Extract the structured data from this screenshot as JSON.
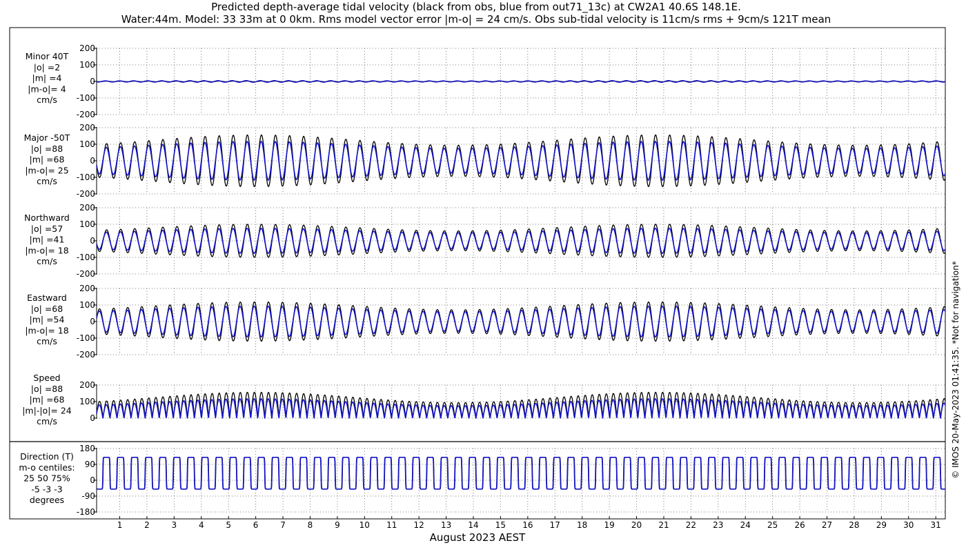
{
  "figure": {
    "title_line1": "Predicted depth-average tidal velocity (black from obs, blue from out71_13c) at CW2A1 40.6S 148.1E.",
    "title_line2": "Water:44m. Model: 33 33m at 0 0km. Rms model vector error |m-o| = 24 cm/s. Obs sub-tidal velocity is 11cm/s rms + 9cm/s 121T mean",
    "xlabel": "August 2023 AEST",
    "credit": "© IMOS 20-May-2023 01:41:35.  *Not for navigation*",
    "colors": {
      "obs": "#000000",
      "model": "#1414c8",
      "grid": "#555555",
      "axes": "#000000"
    }
  },
  "chart_data": {
    "type": "line",
    "x_unit": "day of August 2023 (AEST)",
    "xlim": [
      0.15,
      31.35
    ],
    "x_ticks": [
      1,
      2,
      3,
      4,
      5,
      6,
      7,
      8,
      9,
      10,
      11,
      12,
      13,
      14,
      15,
      16,
      17,
      18,
      19,
      20,
      21,
      22,
      23,
      24,
      25,
      26,
      27,
      28,
      29,
      30,
      31
    ],
    "x_tick_labels": [
      "1",
      "2",
      "3",
      "4",
      "5",
      "6",
      "7",
      "8",
      "9",
      "10",
      "11",
      "12",
      "13",
      "14",
      "15",
      "16",
      "17",
      "18",
      "19",
      "20",
      "21",
      "22",
      "23",
      "24",
      "25",
      "26",
      "27",
      "28",
      "29",
      "30",
      "31"
    ],
    "grid": true,
    "panels": [
      {
        "label_lines": [
          "Minor 40T",
          "|o| =2",
          "|m| =4",
          "|m-o|= 4",
          "cm/s"
        ],
        "ylim": [
          -200,
          200
        ],
        "y_ticks": [
          -200,
          -100,
          0,
          100,
          200
        ],
        "y_tick_labels": [
          "-200",
          "-100",
          "0",
          "100",
          "200"
        ],
        "kind": "harmonic",
        "series": [
          {
            "amplitude": 2,
            "spring_neap": 0.2,
            "phase_deg": 0
          },
          {
            "amplitude": 4,
            "spring_neap": 0.2,
            "phase_deg": 30
          }
        ]
      },
      {
        "label_lines": [
          "Major -50T",
          "|o| =88",
          "|m| =68",
          "|m-o|= 25",
          "cm/s"
        ],
        "ylim": [
          -200,
          200
        ],
        "y_ticks": [
          -200,
          -100,
          0,
          100,
          200
        ],
        "y_tick_labels": [
          "-200",
          "-100",
          "0",
          "100",
          "200"
        ],
        "kind": "harmonic",
        "series": [
          {
            "amplitude": 125,
            "spring_neap": 0.25,
            "phase_deg": 0
          },
          {
            "amplitude": 96,
            "spring_neap": 0.22,
            "phase_deg": 6
          }
        ]
      },
      {
        "label_lines": [
          "Northward",
          "|o| =57",
          "|m| =41",
          "|m-o|= 18",
          "cm/s"
        ],
        "ylim": [
          -200,
          200
        ],
        "y_ticks": [
          -200,
          -100,
          0,
          100,
          200
        ],
        "y_tick_labels": [
          "-200",
          "-100",
          "0",
          "100",
          "200"
        ],
        "kind": "harmonic",
        "series": [
          {
            "amplitude": 80,
            "spring_neap": 0.25,
            "phase_deg": 0
          },
          {
            "amplitude": 62,
            "spring_neap": 0.22,
            "phase_deg": 6
          }
        ]
      },
      {
        "label_lines": [
          "Eastward",
          "|o| =68",
          "|m| =54",
          "|m-o|= 18",
          "cm/s"
        ],
        "ylim": [
          -200,
          200
        ],
        "y_ticks": [
          -200,
          -100,
          0,
          100,
          200
        ],
        "y_tick_labels": [
          "-200",
          "-100",
          "0",
          "100",
          "200"
        ],
        "kind": "harmonic",
        "series": [
          {
            "amplitude": 95,
            "spring_neap": 0.25,
            "phase_deg": 180
          },
          {
            "amplitude": 76,
            "spring_neap": 0.22,
            "phase_deg": 186
          }
        ]
      },
      {
        "label_lines": [
          "Speed",
          "|o| =88",
          "|m| =68",
          "|m|-|o|= 24",
          "cm/s"
        ],
        "ylim": [
          0,
          200
        ],
        "y_ticks": [
          0,
          100,
          200
        ],
        "y_tick_labels": [
          "0",
          "100",
          "200"
        ],
        "kind": "speed",
        "series": [
          {
            "amplitude": 125,
            "spring_neap": 0.25,
            "phase_deg": 0
          },
          {
            "amplitude": 96,
            "spring_neap": 0.22,
            "phase_deg": 6
          }
        ]
      },
      {
        "label_lines": [
          "Direction (T)",
          "m-o centiles:",
          "25  50  75%",
          "-5 -3 -3",
          "degrees"
        ],
        "ylim": [
          -180,
          180
        ],
        "y_ticks": [
          -180,
          -90,
          0,
          90,
          180
        ],
        "y_tick_labels": [
          "-180",
          "-90",
          "0",
          "90",
          "180"
        ],
        "kind": "direction",
        "separated": true,
        "series": [
          {
            "upper_deg": 130,
            "lower_deg": -50,
            "phase_deg": 0
          },
          {
            "upper_deg": 130,
            "lower_deg": -50,
            "phase_deg": 6
          }
        ]
      }
    ],
    "tide": {
      "semidiurnal_period_hours": 12.42,
      "spring_neap_period_days": 14.77,
      "spring_peak_day": 6.0
    }
  }
}
